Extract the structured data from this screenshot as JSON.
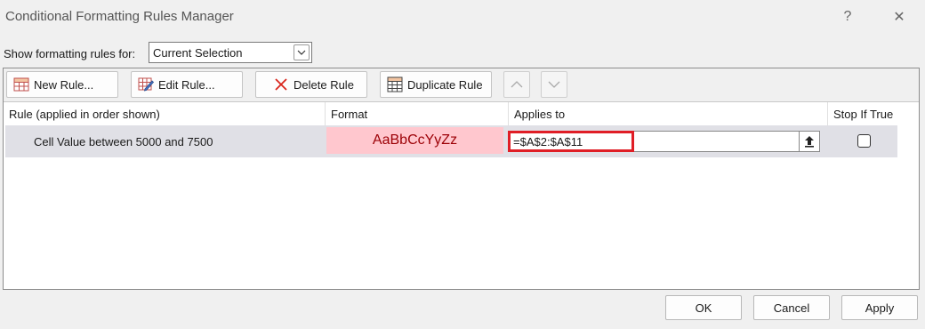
{
  "window": {
    "title": "Conditional Formatting Rules Manager",
    "help_glyph": "?",
    "close_glyph": "✕"
  },
  "show_rules": {
    "label": "Show formatting rules for:",
    "selected": "Current Selection"
  },
  "toolbar": {
    "new_rule": "New Rule...",
    "edit_rule": "Edit Rule...",
    "delete_rule": "Delete Rule",
    "duplicate_rule": "Duplicate Rule"
  },
  "table": {
    "columns": [
      "Rule (applied in order shown)",
      "Format",
      "Applies to",
      "Stop If True"
    ],
    "rows": [
      {
        "rule": "Cell Value between 5000 and 7500",
        "format_preview": "AaBbCcYyZz",
        "applies_to": "=$A$2:$A$11",
        "stop_if_true": false
      }
    ]
  },
  "colors": {
    "format_fill": "#ffc7ce",
    "format_text": "#9c0006",
    "highlight": "#e01e26",
    "selected_row": "#e0e0e6"
  },
  "footer": {
    "ok": "OK",
    "cancel": "Cancel",
    "apply": "Apply"
  }
}
